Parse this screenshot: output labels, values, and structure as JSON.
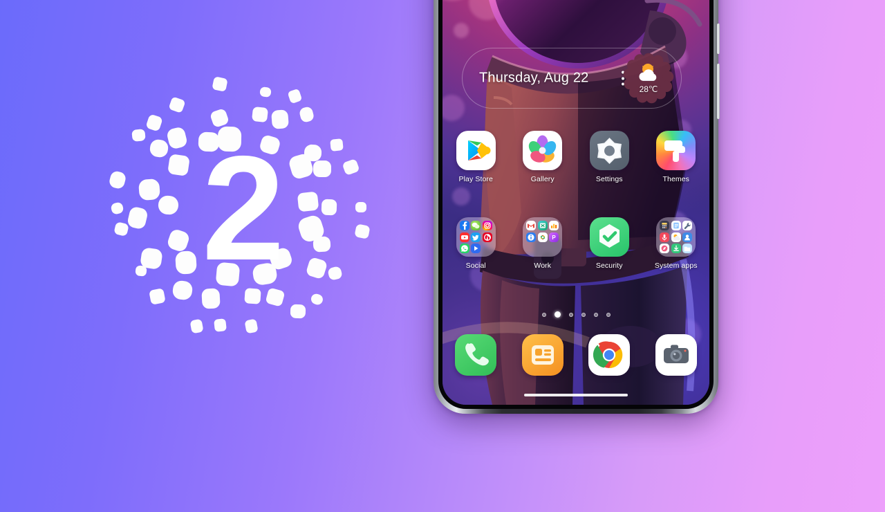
{
  "background": {
    "gradient_from": "#6B6BFB",
    "gradient_to": "#EDA0FB"
  },
  "logo": {
    "name": "dotted-circle-logo",
    "center_text": "2",
    "dot_color": "#FFFFFF"
  },
  "phone": {
    "frame_color": "#232529",
    "screen": {
      "wallpaper_description": "astronaut in helmet on pink purple bokeh background",
      "date_widget": {
        "date_text": "Thursday, Aug 22",
        "menu_icon": "more-vertical-icon",
        "weather": {
          "icon": "sun-behind-cloud-icon",
          "temperature": "28℃",
          "badge_color": "#6B2F45"
        }
      },
      "apps_row": [
        {
          "label": "Play Store",
          "icon": "play-store-icon",
          "tile_color": "#FFFFFF"
        },
        {
          "label": "Gallery",
          "icon": "gallery-icon",
          "tile_color": "#FFFFFF"
        },
        {
          "label": "Settings",
          "icon": "settings-gear-icon",
          "tile_color": "#5F6B78"
        },
        {
          "label": "Themes",
          "icon": "paint-roller-icon",
          "tile_color": "#E05BD0"
        }
      ],
      "folders_row": [
        {
          "label": "Social",
          "icon": "folder-social-icon",
          "apps": [
            "facebook-icon",
            "wechat-icon",
            "instagram-icon",
            "youtube-icon",
            "twitter-icon",
            "pinterest-icon",
            "whatsapp-icon",
            "play-icon",
            ""
          ]
        },
        {
          "label": "Work",
          "icon": "folder-work-icon",
          "apps": [
            "gmail-icon",
            "excel-icon",
            "charts-icon",
            "info-icon",
            "photos-icon",
            "powerpoint-icon",
            "",
            "",
            ""
          ]
        },
        {
          "label": "Security",
          "icon": "security-shield-check-icon",
          "tile_color": "#3FD47E"
        },
        {
          "label": "System apps",
          "icon": "folder-system-icon",
          "apps": [
            "calculator-icon",
            "notes-icon",
            "tools-icon",
            "recorder-icon",
            "weather-icon",
            "contacts-icon",
            "compass-icon",
            "downloads-icon",
            "files-icon"
          ]
        }
      ],
      "dock_row": [
        {
          "label": "",
          "icon": "phone-icon",
          "tile_color": "#4CC764"
        },
        {
          "label": "",
          "icon": "messages-icon",
          "tile_color": "#F6A62A"
        },
        {
          "label": "",
          "icon": "chrome-icon",
          "tile_color": "#FFFFFF"
        },
        {
          "label": "",
          "icon": "camera-icon",
          "tile_color": "#FFFFFF"
        }
      ],
      "page_indicator": {
        "total": 6,
        "active_index": 1
      },
      "gesture_bar": "home-gesture-bar"
    },
    "buttons": [
      {
        "name": "power-button"
      },
      {
        "name": "volume-button"
      }
    ]
  }
}
